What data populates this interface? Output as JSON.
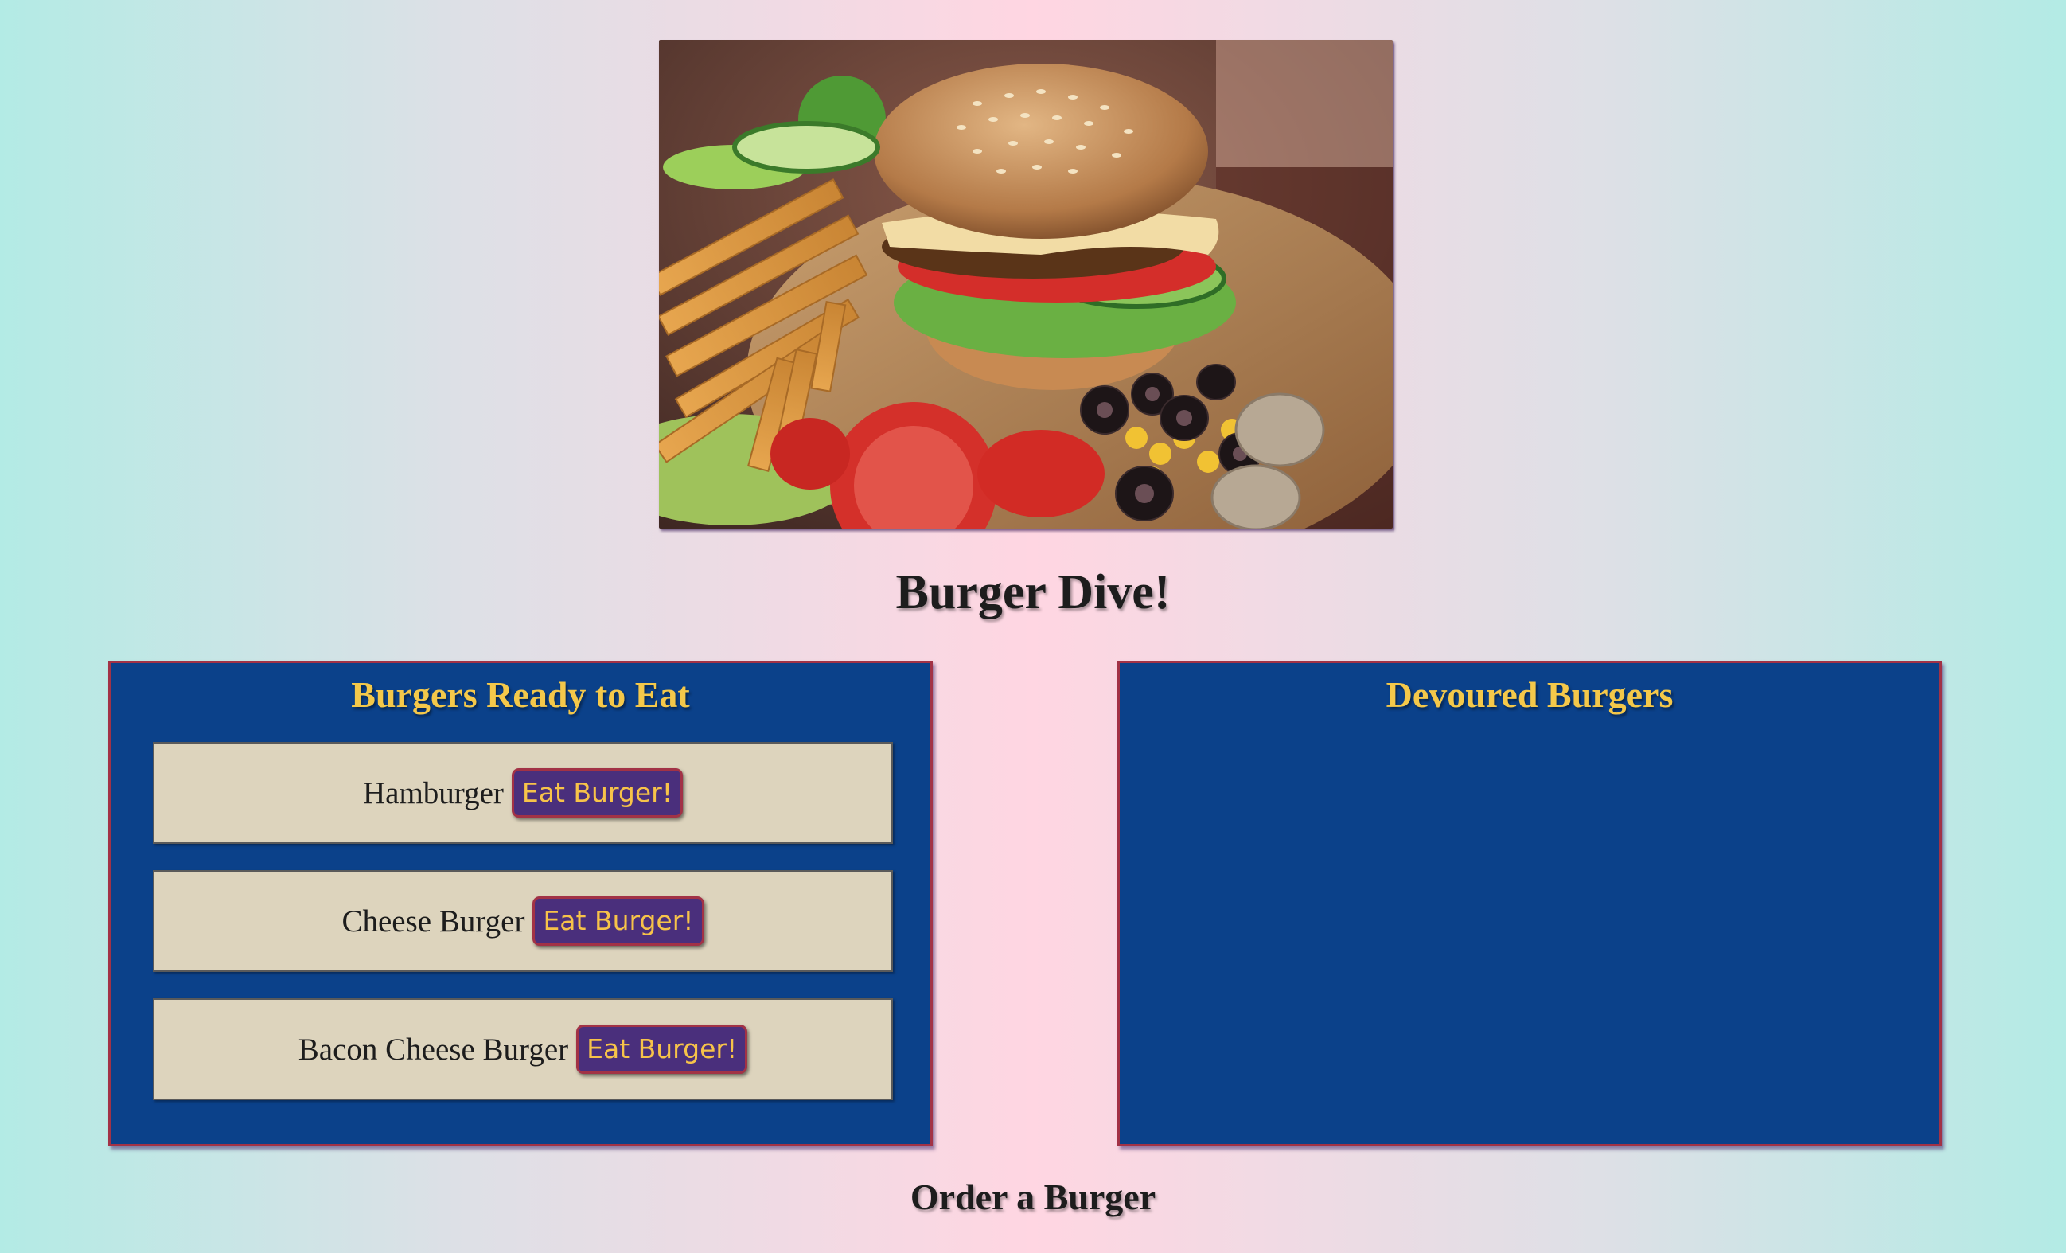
{
  "site": {
    "title": "Burger Dive!"
  },
  "hero": {
    "image": "burger-and-fries-photo"
  },
  "ready_panel": {
    "title": "Burgers Ready to Eat",
    "items": [
      {
        "name": "Hamburger",
        "button_label": "Eat Burger!"
      },
      {
        "name": "Cheese Burger",
        "button_label": "Eat Burger!"
      },
      {
        "name": "Bacon Cheese Burger",
        "button_label": "Eat Burger!"
      }
    ]
  },
  "devoured_panel": {
    "title": "Devoured Burgers",
    "items": []
  },
  "order": {
    "title": "Order a Burger"
  },
  "colors": {
    "panel_bg": "#0b418a",
    "panel_border": "#a23246",
    "panel_title": "#f4c84a",
    "item_bg": "#ddd4bd",
    "button_bg": "#4a2f7c",
    "button_text": "#f7c349"
  }
}
